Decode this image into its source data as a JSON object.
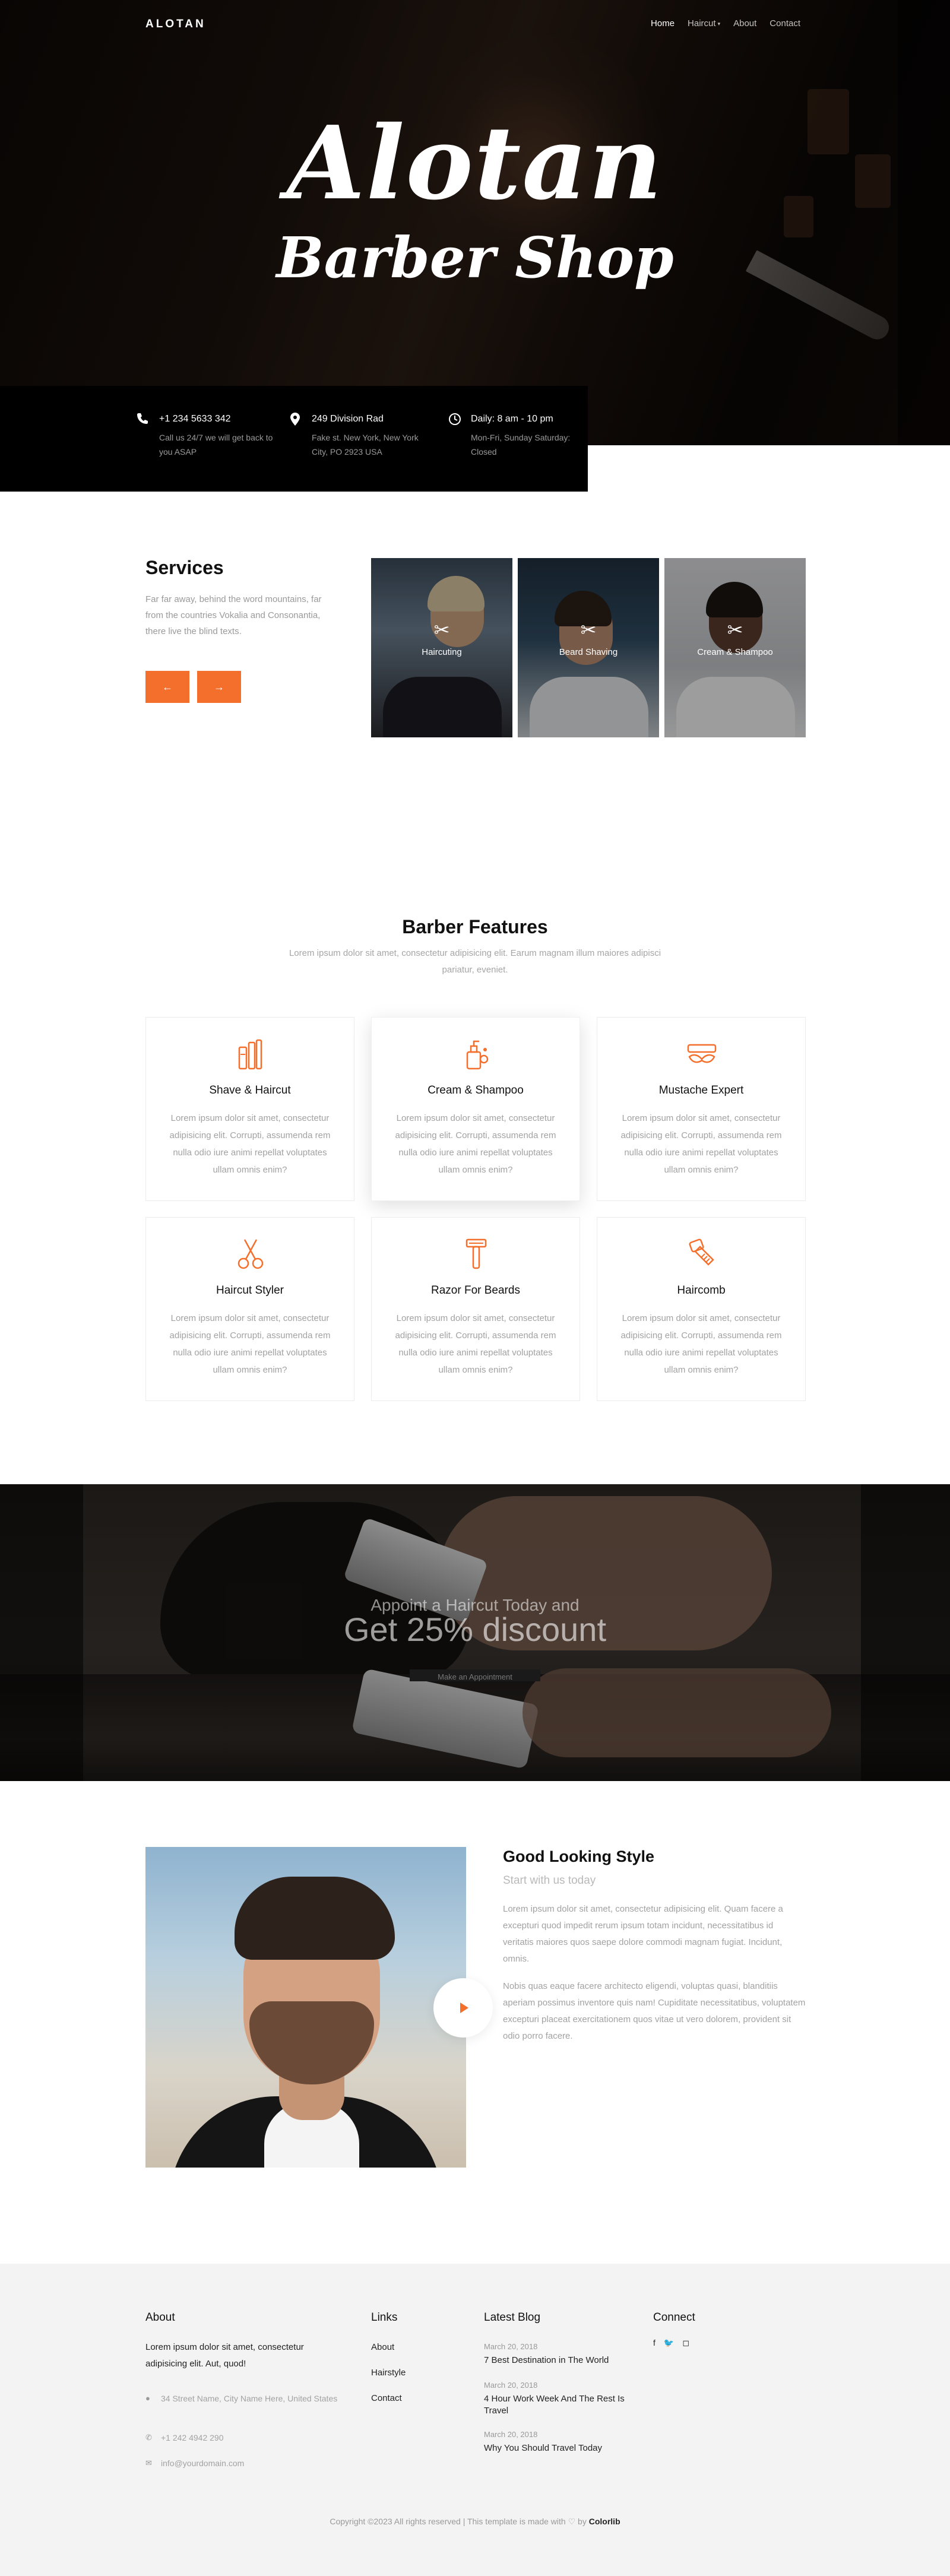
{
  "nav": {
    "brand": "ALOTAN",
    "items": [
      {
        "label": "Home"
      },
      {
        "label": "Haircut"
      },
      {
        "label": "About"
      },
      {
        "label": "Contact"
      }
    ]
  },
  "hero": {
    "title": "Alotan",
    "subtitle": "Barber Shop"
  },
  "info": [
    {
      "icon": "phone-icon",
      "title": "+1 234 5633 342",
      "desc": "Call us 24/7 we will get back to you ASAP"
    },
    {
      "icon": "map-pin-icon",
      "title": "249 Division Rad",
      "desc": "Fake st. New York, New York City, PO 2923 USA"
    },
    {
      "icon": "clock-icon",
      "title": "Daily: 8 am - 10 pm",
      "desc": "Mon-Fri, Sunday Saturday: Closed"
    }
  ],
  "services": {
    "title": "Services",
    "desc": "Far far away, behind the word mountains, far from the countries Vokalia and Consonantia, there live the blind texts.",
    "prev_label": "←",
    "next_label": "→",
    "cards": [
      {
        "label": "Haircuting"
      },
      {
        "label": "Beard Shaving"
      },
      {
        "label": "Cream & Shampoo"
      }
    ]
  },
  "features": {
    "title": "Barber Features",
    "subtitle": "Lorem ipsum dolor sit amet, consectetur adipisicing elit. Earum magnam illum maiores adipisci pariatur, eveniet.",
    "items": [
      {
        "icon": "shave-kit-icon",
        "title": "Shave & Haircut",
        "text": "Lorem ipsum dolor sit amet, consectetur adipisicing elit. Corrupti, assumenda rem nulla odio iure animi repellat voluptates ullam omnis enim?"
      },
      {
        "icon": "cream-bottle-icon",
        "title": "Cream & Shampoo",
        "text": "Lorem ipsum dolor sit amet, consectetur adipisicing elit. Corrupti, assumenda rem nulla odio iure animi repellat voluptates ullam omnis enim?"
      },
      {
        "icon": "mustache-icon",
        "title": "Mustache Expert",
        "text": "Lorem ipsum dolor sit amet, consectetur adipisicing elit. Corrupti, assumenda rem nulla odio iure animi repellat voluptates ullam omnis enim?"
      },
      {
        "icon": "scissors-icon",
        "title": "Haircut Styler",
        "text": "Lorem ipsum dolor sit amet, consectetur adipisicing elit. Corrupti, assumenda rem nulla odio iure animi repellat voluptates ullam omnis enim?"
      },
      {
        "icon": "razor-icon",
        "title": "Razor For Beards",
        "text": "Lorem ipsum dolor sit amet, consectetur adipisicing elit. Corrupti, assumenda rem nulla odio iure animi repellat voluptates ullam omnis enim?"
      },
      {
        "icon": "comb-icon",
        "title": "Haircomb",
        "text": "Lorem ipsum dolor sit amet, consectetur adipisicing elit. Corrupti, assumenda rem nulla odio iure animi repellat voluptates ullam omnis enim?"
      }
    ]
  },
  "discount": {
    "kicker": "Appoint a Haircut Today and",
    "headline": "Get 25% discount",
    "cta": "Make an Appointment"
  },
  "style": {
    "title": "Good Looking Style",
    "subtitle": "Start with us today",
    "p1": "Lorem ipsum dolor sit amet, consectetur adipisicing elit. Quam facere a excepturi quod impedit rerum ipsum totam incidunt, necessitatibus id veritatis maiores quos saepe dolore commodi magnam fugiat. Incidunt, omnis.",
    "p2": "Nobis quas eaque facere architecto eligendi, voluptas quasi, blanditiis aperiam possimus inventore quis nam! Cupiditate necessitatibus, voluptatem excepturi placeat exercitationem quos vitae ut vero dolorem, provident sit odio porro facere."
  },
  "footer": {
    "about_title": "About",
    "about_text": "Lorem ipsum dolor sit amet, consectetur adipisicing elit. Aut, quod!",
    "address": "34 Street Name, City Name Here, United States",
    "phone": "+1 242 4942 290",
    "email": "info@yourdomain.com",
    "links_title": "Links",
    "links": [
      "About",
      "Hairstyle",
      "Contact"
    ],
    "blog_title": "Latest Blog",
    "posts": [
      {
        "date": "March 20, 2018",
        "title": "7 Best Destination in The World"
      },
      {
        "date": "March 20, 2018",
        "title": "4 Hour Work Week And The Rest Is Travel"
      },
      {
        "date": "March 20, 2018",
        "title": "Why You Should Travel Today"
      }
    ],
    "connect_title": "Connect",
    "social": [
      "facebook-icon",
      "twitter-icon",
      "instagram-icon"
    ],
    "copyright_pre": "Copyright ©2023 All rights reserved | This template is made with",
    "copyright_by": "by",
    "brand": "Colorlib"
  },
  "colors": {
    "accent": "#f36f2b",
    "hero_bg": "#1b120d",
    "footer_bg": "#f3f3f3"
  }
}
